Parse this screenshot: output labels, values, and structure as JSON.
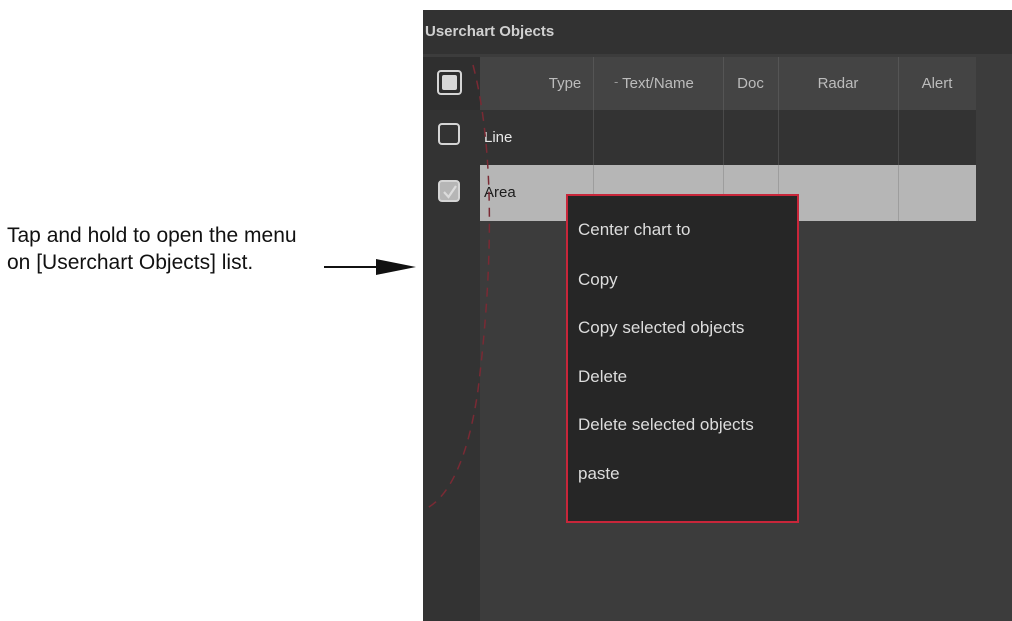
{
  "callout": {
    "line1": "Tap and hold to open the menu",
    "line2": "on [Userchart Objects] list."
  },
  "panel": {
    "title": "Userchart Objects",
    "columns": [
      "Type",
      "Text/Name",
      "Doc",
      "Radar",
      "Alert"
    ],
    "sort_indicator": "-",
    "rows": [
      {
        "type": "Line",
        "checked": false
      },
      {
        "type": "Area",
        "checked": true
      }
    ]
  },
  "context_menu": {
    "items": [
      "Center chart to",
      "Copy",
      "Copy selected objects",
      "Delete",
      "Delete selected objects",
      "paste"
    ]
  },
  "colors": {
    "menu_border": "#c8263a",
    "panel_bg": "#3c3c3c",
    "selected_row": "#b6b6b6"
  }
}
